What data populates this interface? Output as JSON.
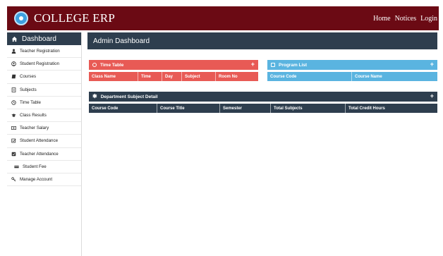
{
  "app": {
    "title": "COLLEGE ERP"
  },
  "topnav": [
    "Home",
    "Notices",
    "Login"
  ],
  "sidebar": {
    "header": "Dashboard",
    "items": [
      {
        "label": "Teacher Registration",
        "icon": "user-icon"
      },
      {
        "label": "Student Registration",
        "icon": "user-circle-icon"
      },
      {
        "label": "Courses",
        "icon": "book-icon"
      },
      {
        "label": "Subjects",
        "icon": "document-icon"
      },
      {
        "label": "Time Table",
        "icon": "clock-icon"
      },
      {
        "label": "Class Results",
        "icon": "graduation-cap-icon"
      },
      {
        "label": "Teacher Salary",
        "icon": "money-icon"
      },
      {
        "label": "Student Attendance",
        "icon": "edit-check-icon"
      },
      {
        "label": "Teacher Attendance",
        "icon": "check-square-icon"
      },
      {
        "label": "Student Fee",
        "icon": "credit-card-icon"
      },
      {
        "label": "Manage Account",
        "icon": "key-icon"
      }
    ]
  },
  "main": {
    "title": "Admin Dashboard",
    "timetable": {
      "title": "Time Table",
      "plus": "+",
      "columns": [
        "Class Name",
        "Time",
        "Day",
        "Subject",
        "Room No"
      ]
    },
    "programs": {
      "title": "Program List",
      "plus": "+",
      "columns": [
        "Course Code",
        "Course Name"
      ]
    },
    "department": {
      "title": "Department Subject Detail",
      "plus": "+",
      "columns": [
        "Course Code",
        "Course Title",
        "Semester",
        "Total Subjects",
        "Total Credit Hours"
      ]
    }
  },
  "colors": {
    "topbar": "#6b0a14",
    "dark": "#2e3e4e",
    "red": "#e85a55",
    "blue": "#5ab4e0"
  }
}
